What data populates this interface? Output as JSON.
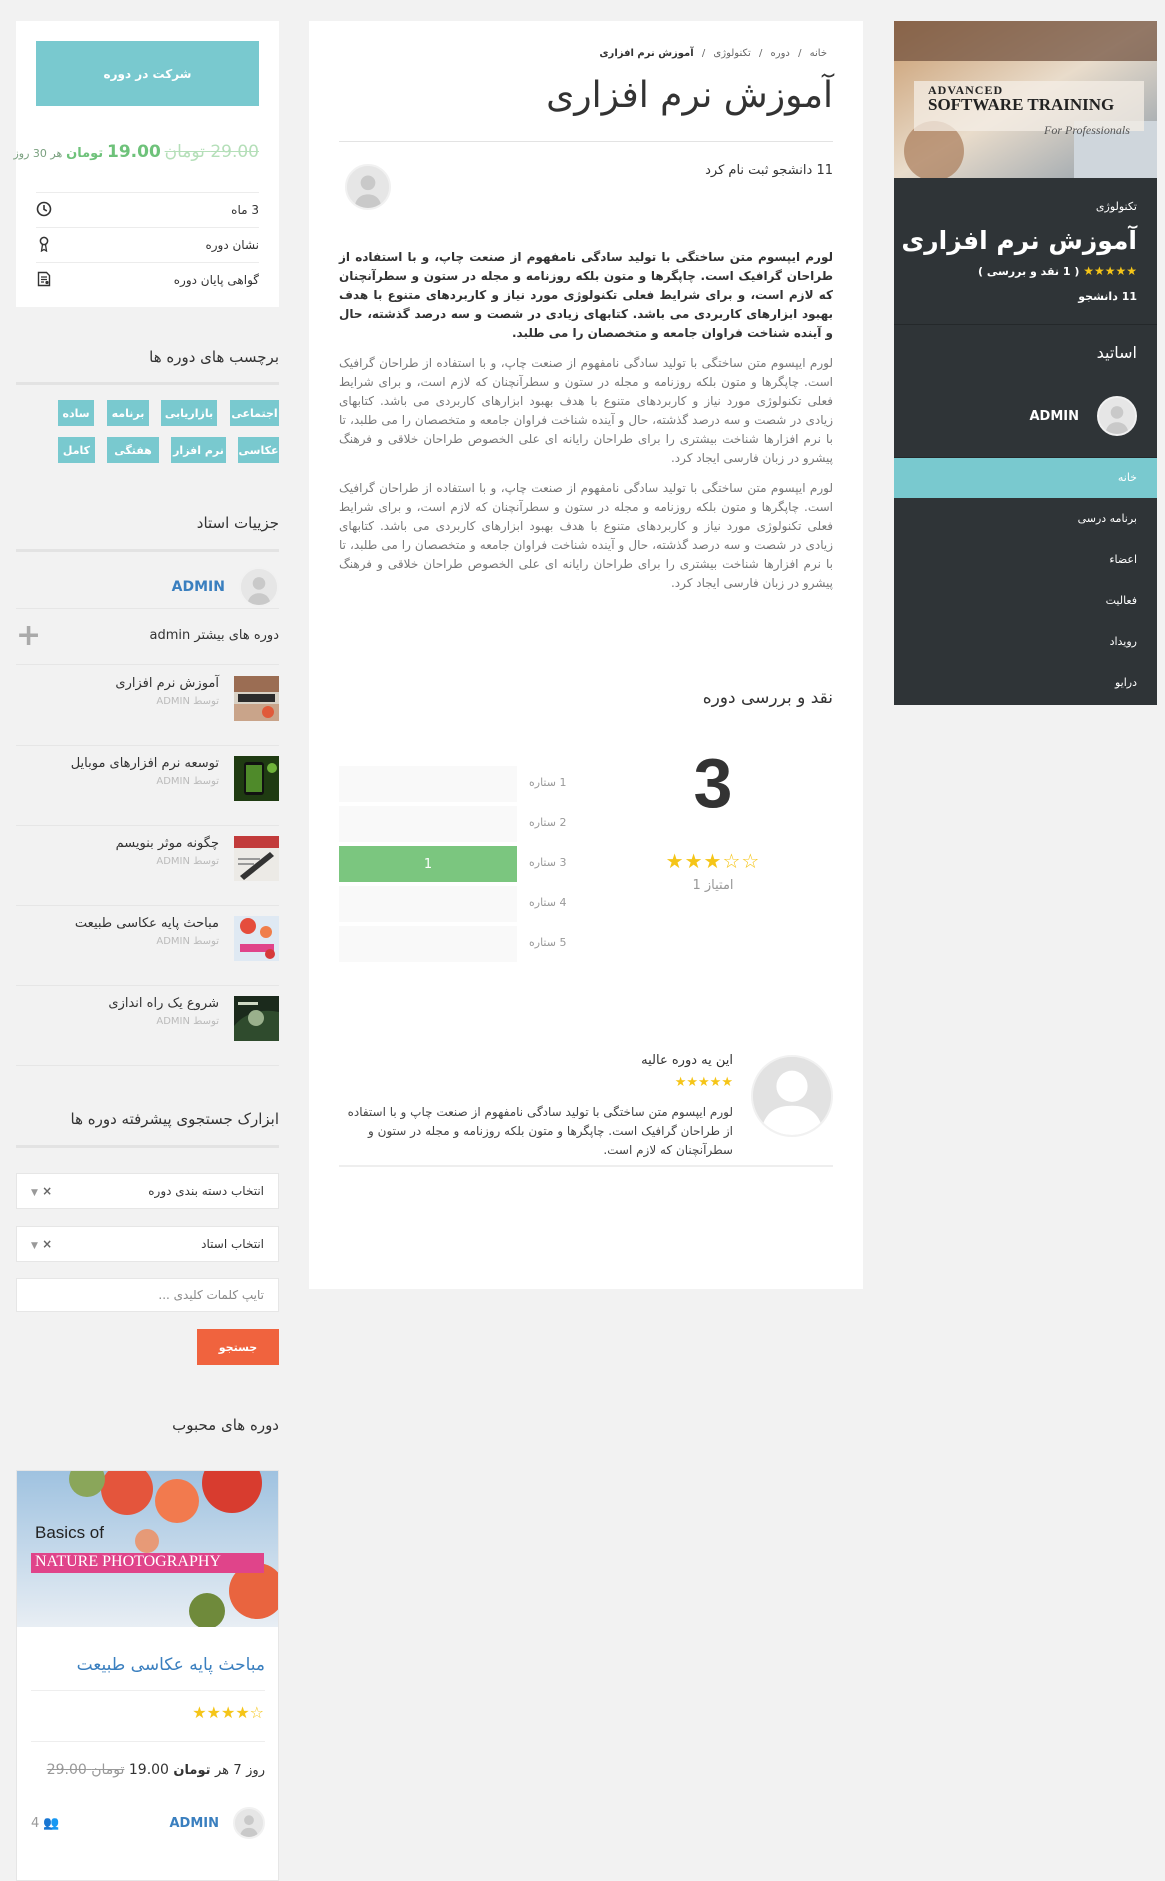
{
  "enroll": {
    "button_label": "شرکت در دوره",
    "price_old": "29.00",
    "price_unit_old": "تومان",
    "price_new": "19.00",
    "price_unit": "تومان",
    "price_per": "هر",
    "duration_value": "30",
    "duration_unit": "روز",
    "meta": [
      {
        "label": "3 ماه",
        "icon": "clock-icon"
      },
      {
        "label": "نشان دوره",
        "icon": "badge-icon"
      },
      {
        "label": "گواهی پایان دوره",
        "icon": "certificate-icon"
      }
    ]
  },
  "tags": {
    "title": "برچسب های دوره ها",
    "items": [
      "اجتماعی",
      "بازاریابی",
      "برنامه",
      "ساده",
      "عکاسی",
      "نرم افزار",
      "هفتگی",
      "کامل"
    ]
  },
  "teacher_details": {
    "title": "جزییات استاد",
    "name": "ADMIN",
    "more_courses": "دوره های بیشتر admin"
  },
  "more_courses": [
    {
      "title": "آموزش نرم افزاری",
      "by": "توسط ADMIN"
    },
    {
      "title": "توسعه نرم افزارهای موبایل",
      "by": "توسط ADMIN"
    },
    {
      "title": "چگونه موثر بنویسم",
      "by": "توسط ADMIN"
    },
    {
      "title": "مباحث پایه عکاسی طبیعت",
      "by": "توسط ADMIN"
    },
    {
      "title": "شروع یک راه اندازی",
      "by": "توسط ADMIN"
    }
  ],
  "search": {
    "title": "ابزارک جستجوی پیشرفته دوره ها",
    "category_placeholder": "انتخاب دسته بندی دوره",
    "teacher_placeholder": "انتخاب استاد",
    "clear": "×",
    "keyword_placeholder": "تایپ کلمات کلیدی ...",
    "button": "جستجو"
  },
  "popular": {
    "title": "دوره های محبوب",
    "image_line1": "Basics of",
    "image_line2": "NATURE PHOTOGRAPHY",
    "course_title": "مباحث پایه عکاسی طبیعت",
    "stars": "★★★★☆",
    "rating_value": 4,
    "price_old": "29.00",
    "price_unit_old": "تومان",
    "price_new": "19.00",
    "price_unit": "تومان",
    "price_per": "هر",
    "duration_value": "7",
    "duration_unit": "روز",
    "teacher": "ADMIN",
    "students": "4"
  },
  "main": {
    "breadcrumb": [
      "خانه",
      "دوره",
      "تکنولوژی",
      "آموزش نرم افزاری"
    ],
    "breadcrumb_sep": "/",
    "title": "آموزش نرم افزاری",
    "students_enrolled": "11 دانشجو ثبت نام کرد",
    "para_bold": "لورم ایپسوم متن ساختگی با تولید سادگی نامفهوم از صنعت چاپ، و با استفاده از طراحان گرافیک است. چاپگرها و متون بلکه روزنامه و مجله در ستون و سطرآنچنان که لازم است، و برای شرایط فعلی تکنولوژی مورد نیاز و کاربردهای متنوع با هدف بهبود ابزارهای کاربردی می باشد. کتابهای زیادی در شصت و سه درصد گذشته، حال و آینده شناخت فراوان جامعه و متخصصان را می طلبد.",
    "para_1": "لورم ایپسوم متن ساختگی با تولید سادگی نامفهوم از صنعت چاپ، و با استفاده از طراحان گرافیک است. چاپگرها و متون بلکه روزنامه و مجله در ستون و سطرآنچنان که لازم است، و برای شرایط فعلی تکنولوژی مورد نیاز و کاربردهای متنوع با هدف بهبود ابزارهای کاربردی می باشد. کتابهای زیادی در شصت و سه درصد گذشته، حال و آینده شناخت فراوان جامعه و متخصصان را می طلبد، تا با نرم افزارها شناخت بیشتری را برای طراحان رایانه ای علی الخصوص طراحان خلاقی و فرهنگ پیشرو در زبان فارسی ایجاد کرد.",
    "para_2": "لورم ایپسوم متن ساختگی با تولید سادگی نامفهوم از صنعت چاپ، و با استفاده از طراحان گرافیک است. چاپگرها و متون بلکه روزنامه و مجله در ستون و سطرآنچنان که لازم است، و برای شرایط فعلی تکنولوژی مورد نیاز و کاربردهای متنوع با هدف بهبود ابزارهای کاربردی می باشد. کتابهای زیادی در شصت و سه درصد گذشته، حال و آینده شناخت فراوان جامعه و متخصصان را می طلبد، تا با نرم افزارها شناخت بیشتری را برای طراحان رایانه ای علی الخصوص طراحان خلاقی و فرهنگ پیشرو در زبان فارسی ایجاد کرد.",
    "reviews_title": "نقد و بررسی دوره",
    "rating": "3",
    "rating_stars": "★★★☆☆",
    "rating_count": "1 امتیاز",
    "bars": [
      {
        "label": "1 ستاره",
        "count": 0,
        "fraction": 0
      },
      {
        "label": "2 ستاره",
        "count": 0,
        "fraction": 0
      },
      {
        "label": "3 ستاره",
        "count": 1,
        "fraction": 1
      },
      {
        "label": "4 ستاره",
        "count": 0,
        "fraction": 0
      },
      {
        "label": "5 ستاره",
        "count": 0,
        "fraction": 0
      }
    ],
    "review": {
      "title": "این یه دوره عالیه",
      "stars": "★★★★★",
      "text": "لورم ایپسوم متن ساختگی با تولید سادگی نامفهوم از صنعت چاپ و با استفاده از طراحان گرافیک است. چاپگرها و متون بلکه روزنامه و مجله در ستون و سطرآنچنان که لازم است."
    }
  },
  "hero": {
    "line1": "ADVANCED",
    "line2": "SOFTWARE TRAINING",
    "line3": "For Professionals"
  },
  "panel": {
    "category": "تکنولوژی",
    "title": "آموزش نرم افزاری",
    "stars": "★★★★★",
    "review_count": "( 1 نقد و بررسی )",
    "students": "11 دانشجو",
    "teachers_title": "اساتید",
    "teacher_name": "ADMIN",
    "nav": [
      "خانه",
      "برنامه درسی",
      "اعضاء",
      "فعالیت",
      "رویداد",
      "درایو"
    ],
    "active_nav": "خانه"
  },
  "colors": {
    "accent": "#79c9cf",
    "green": "#7bc67f",
    "orange": "#f0633e",
    "star": "#f5c518",
    "dark_panel": "#2f3437",
    "link": "#3a7fbf"
  }
}
